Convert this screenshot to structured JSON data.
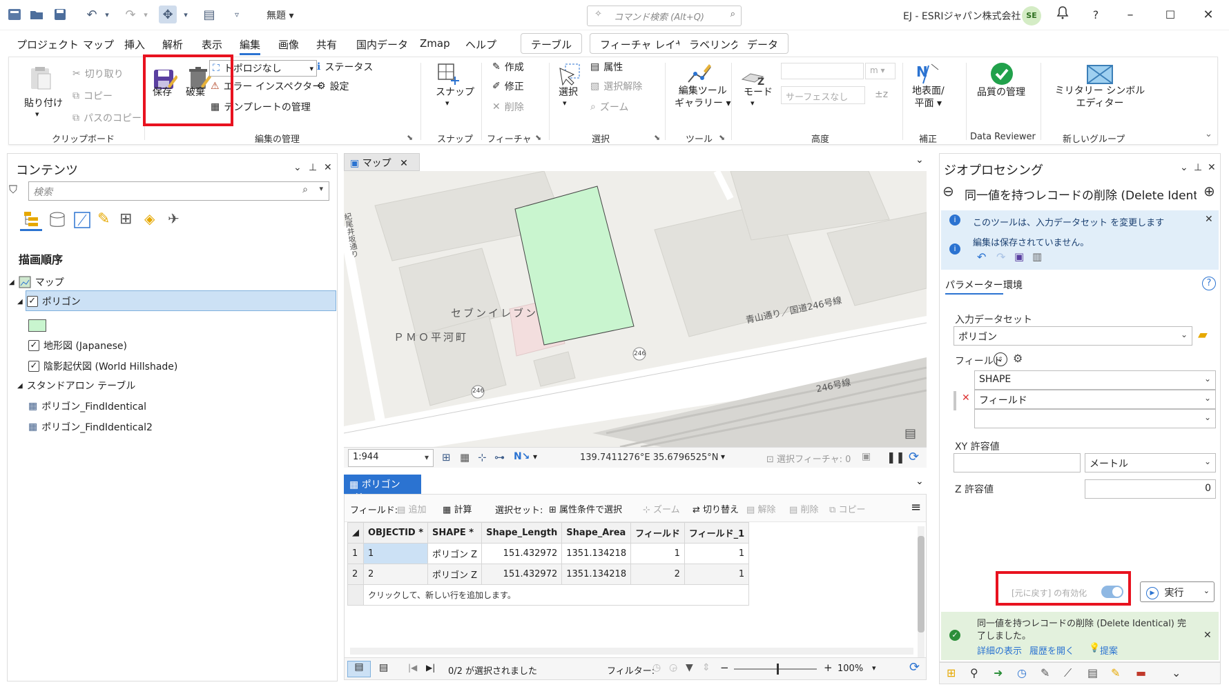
{
  "title_bar": {
    "doc_title": "無題",
    "search_placeholder": "コマンド検索 (Alt+Q)",
    "account": "EJ - ESRIジャパン株式会社",
    "avatar_initials": "SE"
  },
  "menu": {
    "items": [
      "プロジェクト",
      "マップ",
      "挿入",
      "解析",
      "表示",
      "編集",
      "画像",
      "共有",
      "国内データ",
      "Zmap",
      "ヘルプ"
    ],
    "active": "編集",
    "context_tabs": [
      "テーブル",
      "フィーチャ レイヤー",
      "ラベリング",
      "データ"
    ]
  },
  "ribbon": {
    "clipboard": {
      "paste": "貼り付け",
      "cut": "切り取り",
      "copy": "コピー",
      "copy_path": "パスのコピー",
      "label": "クリップボード"
    },
    "manage_edits": {
      "save": "保存",
      "discard": "破棄",
      "topology": "トポロジなし",
      "error_inspector": "エラー インスペクター",
      "template_mgmt": "テンプレートの管理",
      "status": "ステータス",
      "settings": "設定",
      "label": "編集の管理"
    },
    "snapping": {
      "snap": "スナップ",
      "label": "スナップ"
    },
    "features": {
      "create": "作成",
      "modify": "修正",
      "delete": "削除",
      "label": "フィーチャ"
    },
    "selection": {
      "select": "選択",
      "attributes": "属性",
      "clear": "選択解除",
      "zoom": "ズーム",
      "label": "選択"
    },
    "tools": {
      "gallery_line1": "編集ツール",
      "gallery_line2": "ギャラリー",
      "label": "ツール"
    },
    "elevation": {
      "mode": "モード",
      "unit": "m",
      "surface_placeholder": "サーフェスなし",
      "label": "高度"
    },
    "correction": {
      "ground_line1": "地表面/",
      "ground_line2": "平面",
      "label": "補正"
    },
    "data_reviewer": {
      "quality": "品質の管理",
      "label": "Data Reviewer"
    },
    "new_group": {
      "military_line1": "ミリタリー シンボル",
      "military_line2": "エディター",
      "label": "新しいグループ"
    }
  },
  "contents": {
    "title": "コンテンツ",
    "search_placeholder": "検索",
    "drawing_order": "描画順序",
    "map_name": "マップ",
    "layer_polygon": "ポリゴン",
    "layer_terrain": "地形図 (Japanese)",
    "layer_hillshade": "陰影起伏図 (World Hillshade)",
    "standalone_tables": "スタンドアロン テーブル",
    "table1": "ポリゴン_FindIdentical",
    "table2": "ポリゴン_FindIdentical2"
  },
  "map": {
    "tab": "マップ",
    "scale": "1:944",
    "coords": "139.7411276°E 35.6796525°N",
    "selected_features": "選択フィーチャ: 0",
    "labels": {
      "seven": "セブンイレブン",
      "pmo": "ＰＭＯ平河町",
      "road": "青山通り／国道246号線",
      "road2": "246号線",
      "route": "246",
      "route2": "246",
      "slope": "紀尾井坂通り"
    }
  },
  "attr_table": {
    "tab": "ポリゴン",
    "fields_label": "フィールド:",
    "add": "追加",
    "calc": "計算",
    "selection_label": "選択セット:",
    "select_by_attr": "属性条件で選択",
    "zoom": "ズーム",
    "switch": "切り替え",
    "clear": "解除",
    "delete": "削除",
    "copy": "コピー",
    "columns": [
      "OBJECTID *",
      "SHAPE *",
      "Shape_Length",
      "Shape_Area",
      "フィールド",
      "フィールド_1"
    ],
    "rows": [
      {
        "num": "1",
        "cells": [
          "1",
          "ポリゴン Z",
          "151.432972",
          "1351.134218",
          "1",
          "1"
        ]
      },
      {
        "num": "2",
        "cells": [
          "2",
          "ポリゴン Z",
          "151.432972",
          "1351.134218",
          "2",
          "1"
        ]
      }
    ],
    "add_row_hint": "クリックして、新しい行を追加します。",
    "selected_count": "0/2 が選択されました",
    "filter_label": "フィルター:",
    "zoom_level": "100%"
  },
  "geoprocessing": {
    "title": "ジオプロセシング",
    "tool_name": "同一値を持つレコードの削除 (Delete Ident...",
    "info_msg": "このツールは、入力データセット を変更します",
    "unsaved_msg": "編集は保存されていません。",
    "tab_params": "パラメーター",
    "tab_env": "環境",
    "input_label": "入力データセット",
    "input_value": "ポリゴン",
    "field_label": "フィールド",
    "field_1": "SHAPE",
    "field_2": "フィールド",
    "field_3": "",
    "xy_label": "XY 許容値",
    "xy_value": "",
    "xy_unit": "メートル",
    "z_label": "Z 許容値",
    "z_value": "0",
    "undo_toggle": "[元に戻す] の有効化",
    "run": "実行",
    "result_line1": "同一値を持つレコードの削除 (Delete Identical) 完",
    "result_line2": "了しました。",
    "view_details": "詳細の表示",
    "open_history": "履歴を開く",
    "suggest": "提案"
  },
  "colors": {
    "accent": "#2b73d1",
    "highlight": "#e8121f",
    "polygon_fill": "#c9f5cf"
  }
}
